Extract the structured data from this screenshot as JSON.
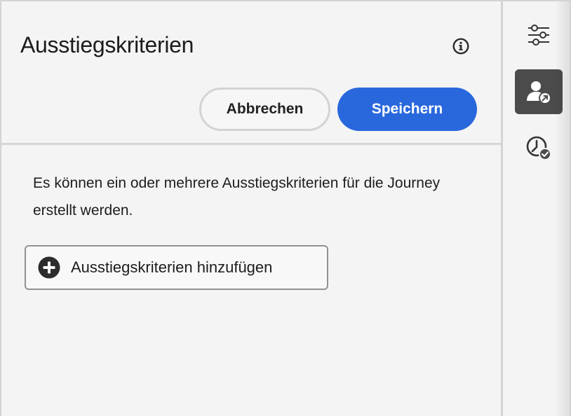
{
  "panel": {
    "title": "Ausstiegskriterien",
    "info_icon": "info-icon",
    "cancel_label": "Abbrechen",
    "save_label": "Speichern",
    "description": "Es können ein oder mehrere Ausstiegskriterien für die Journey erstellt werden.",
    "add_button_label": "Ausstiegskriterien hinzufügen",
    "add_icon": "add-circle-icon"
  },
  "rail": {
    "items": [
      {
        "icon": "settings-sliders-icon",
        "active": false
      },
      {
        "icon": "user-exit-icon",
        "active": true
      },
      {
        "icon": "clock-check-icon",
        "active": false
      }
    ]
  },
  "colors": {
    "primary": "#2968dc",
    "active_rail": "#4b4b4b",
    "background": "#f4f4f4"
  }
}
